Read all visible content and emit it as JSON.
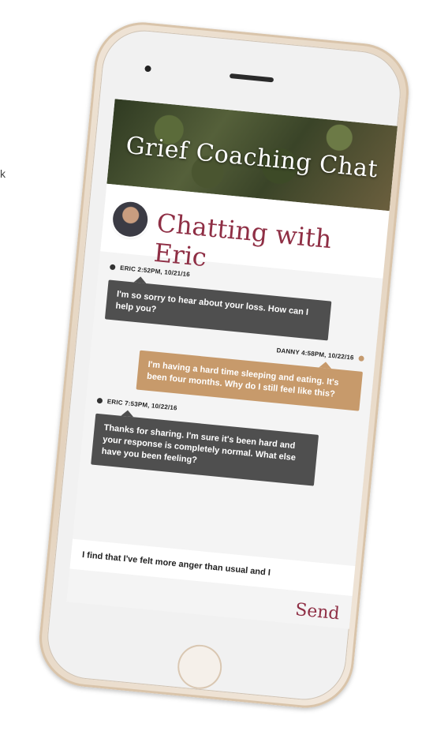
{
  "edge_text": "k",
  "screen": {
    "banner_title": "Grief Coaching Chat",
    "chat_title": "Chatting with Eric",
    "messages": [
      {
        "sender": "eric",
        "meta": "ERIC 2:52PM, 10/21/16",
        "text": "I'm so sorry to hear about your loss. How can I help you?"
      },
      {
        "sender": "danny",
        "meta": "DANNY 4:58PM, 10/22/16",
        "text": "I'm having a hard time sleeping and eating. It's been four months. Why do I still feel like this?"
      },
      {
        "sender": "eric",
        "meta": "ERIC 7:53PM, 10/22/16",
        "text": "Thanks for sharing. I'm sure it's been hard and your response is completely normal. What else have you been feeling?"
      }
    ],
    "input_value": "I find that I've felt more anger than usual and I",
    "send_label": "Send"
  },
  "colors": {
    "eric_bubble": "#4f4f4f",
    "danny_bubble": "#c79a6b",
    "accent": "#8f2f45"
  },
  "icons": [
    "avatar",
    "camera-icon",
    "speaker-icon",
    "home-button-icon"
  ]
}
